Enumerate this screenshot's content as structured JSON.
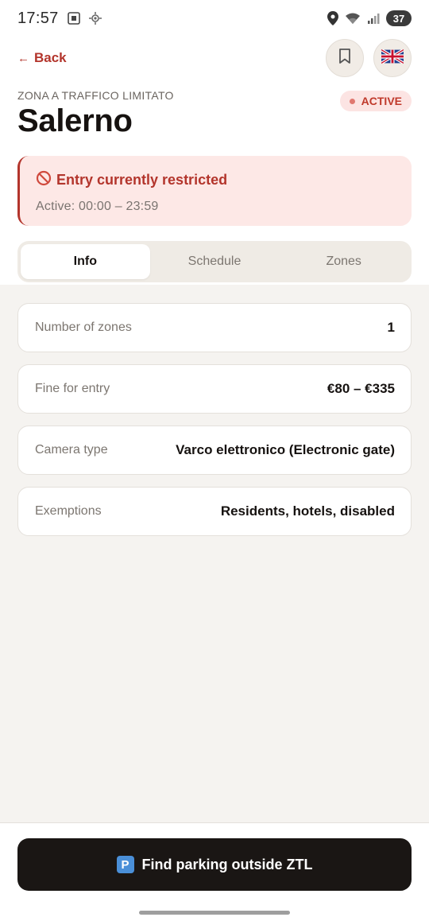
{
  "status_bar": {
    "time": "17:57",
    "battery": "37",
    "icons": [
      "screenshot-icon",
      "location-crosshair-icon",
      "location-pin-icon",
      "wifi-icon",
      "signal-icon"
    ]
  },
  "nav": {
    "back_label": "Back",
    "back_arrow": "←",
    "bookmark_icon": "bookmark-icon",
    "language_flag": "🇬🇧"
  },
  "header": {
    "eyebrow": "ZONA A TRAFFICO LIMITATO",
    "title": "Salerno",
    "status_badge": "ACTIVE"
  },
  "alert": {
    "icon": "🚫",
    "title": "Entry currently restricted",
    "subtitle": "Active: 00:00 – 23:59"
  },
  "tabs": [
    {
      "label": "Info",
      "active": true
    },
    {
      "label": "Schedule",
      "active": false
    },
    {
      "label": "Zones",
      "active": false
    }
  ],
  "info_rows": [
    {
      "label": "Number of zones",
      "value": "1"
    },
    {
      "label": "Fine for entry",
      "value": "€80 – €335"
    },
    {
      "label": "Camera type",
      "value": "Varco elettronico (Electronic gate)"
    },
    {
      "label": "Exemptions",
      "value": "Residents, hotels, disabled"
    }
  ],
  "cta": {
    "icon": "P",
    "label": "Find parking outside ZTL"
  },
  "colors": {
    "accent_red": "#b3352c",
    "alert_bg": "#fde8e6",
    "cta_bg": "#1a1614",
    "content_bg": "#f5f3f0"
  }
}
